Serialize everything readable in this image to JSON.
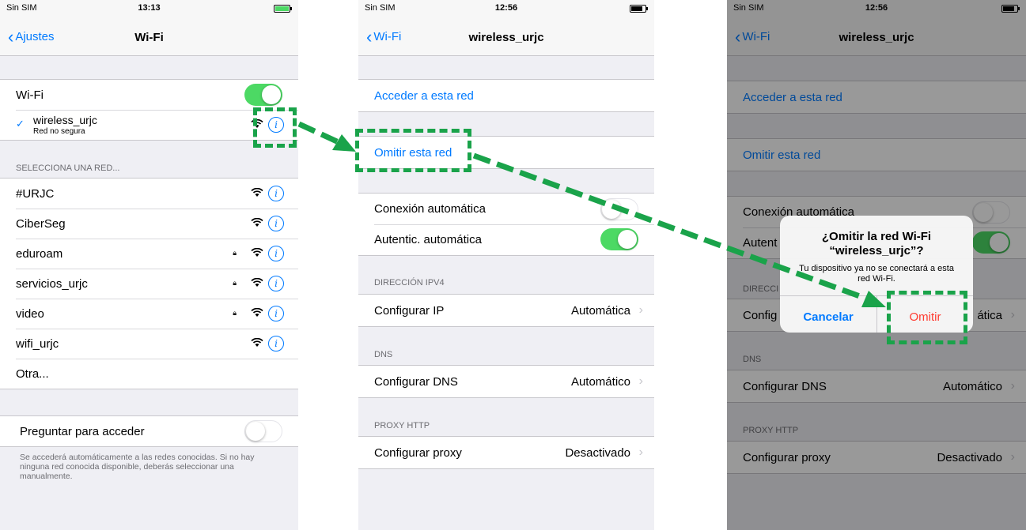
{
  "colors": {
    "ios_blue": "#007aff",
    "ios_green": "#4cd964",
    "ios_red": "#ff3b30",
    "annotation_green": "#1aa34a"
  },
  "screen1": {
    "status": {
      "carrier": "Sin SIM",
      "time": "13:13"
    },
    "nav": {
      "back": "Ajustes",
      "title": "Wi-Fi"
    },
    "wifi_label": "Wi-Fi",
    "wifi_on": true,
    "connected": {
      "name": "wireless_urjc",
      "sub": "Red no segura"
    },
    "section_header": "SELECCIONA UNA RED...",
    "networks": [
      {
        "name": "#URJC",
        "locked": false
      },
      {
        "name": "CiberSeg",
        "locked": false
      },
      {
        "name": "eduroam",
        "locked": true
      },
      {
        "name": "servicios_urjc",
        "locked": true
      },
      {
        "name": "video",
        "locked": true
      },
      {
        "name": "wifi_urjc",
        "locked": false
      }
    ],
    "other": "Otra...",
    "ask_label": "Preguntar para acceder",
    "ask_on": false,
    "footer": "Se accederá automáticamente a las redes conocidas. Si no hay ninguna red conocida disponible, deberás seleccionar una manualmente."
  },
  "screen2": {
    "status": {
      "carrier": "Sin SIM",
      "time": "12:56"
    },
    "nav": {
      "back": "Wi-Fi",
      "title": "wireless_urjc"
    },
    "join": "Acceder a esta red",
    "forget": "Omitir esta red",
    "auto_join": "Conexión automática",
    "auto_join_on": false,
    "auto_login": "Autentic. automática",
    "auto_login_on": true,
    "ipv4_header": "DIRECCIÓN IPV4",
    "configure_ip": "Configurar IP",
    "configure_ip_value": "Automática",
    "dns_header": "DNS",
    "configure_dns": "Configurar DNS",
    "configure_dns_value": "Automático",
    "proxy_header": "PROXY HTTP",
    "configure_proxy": "Configurar proxy",
    "configure_proxy_value": "Desactivado"
  },
  "screen3": {
    "status": {
      "carrier": "Sin SIM",
      "time": "12:56"
    },
    "nav": {
      "back": "Wi-Fi",
      "title": "wireless_urjc"
    },
    "join": "Acceder a esta red",
    "forget": "Omitir esta red",
    "auto_join": "Conexión automática",
    "auto_login": "Autent",
    "ipv4_header": "DIRECCI",
    "configure_ip": "Config",
    "configure_ip_value": "ática",
    "dns_header": "DNS",
    "configure_dns": "Configurar DNS",
    "configure_dns_value": "Automático",
    "proxy_header": "PROXY HTTP",
    "configure_proxy": "Configurar proxy",
    "configure_proxy_value": "Desactivado",
    "alert": {
      "title": "¿Omitir la red Wi-Fi “wireless_urjc”?",
      "message": "Tu dispositivo ya no se conectará a esta red Wi-Fi.",
      "cancel": "Cancelar",
      "confirm": "Omitir"
    }
  }
}
